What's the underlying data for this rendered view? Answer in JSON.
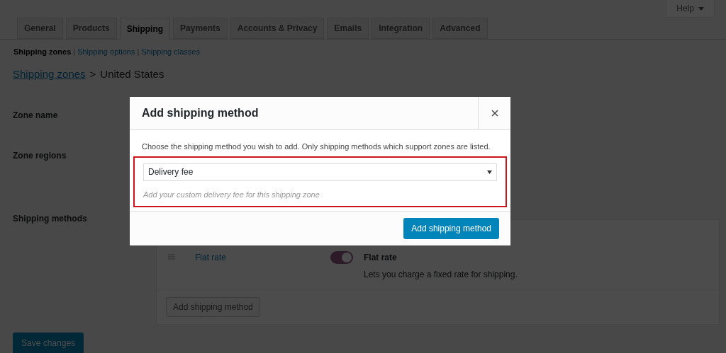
{
  "help_button": {
    "label": "Help"
  },
  "tabs": [
    {
      "label": "General",
      "selected": false
    },
    {
      "label": "Products",
      "selected": false
    },
    {
      "label": "Shipping",
      "selected": true
    },
    {
      "label": "Payments",
      "selected": false
    },
    {
      "label": "Accounts & Privacy",
      "selected": false
    },
    {
      "label": "Emails",
      "selected": false
    },
    {
      "label": "Integration",
      "selected": false
    },
    {
      "label": "Advanced",
      "selected": false
    }
  ],
  "subnav": [
    {
      "label": "Shipping zones",
      "selected": true
    },
    {
      "label": "Shipping options",
      "selected": false,
      "separator_before": "|"
    },
    {
      "label": "Shipping classes",
      "selected": false,
      "separator_before": "|"
    }
  ],
  "breadcrumb": {
    "link": "Shipping zones",
    "separator": ">",
    "current": "United States"
  },
  "fields": [
    {
      "label": "Zone name",
      "kind": "short"
    },
    {
      "label": "Zone regions",
      "kind": "tall"
    },
    {
      "label": "Shipping methods",
      "kind": "methods"
    }
  ],
  "methods": [
    {
      "title": "Flat rate",
      "enabled": true,
      "description_title": "Flat rate",
      "description": "Lets you charge a fixed rate for shipping."
    }
  ],
  "methods_add_button": "Add shipping method",
  "save_button": "Save changes",
  "modal": {
    "title": "Add shipping method",
    "description": "Choose the shipping method you wish to add. Only shipping methods which support zones are listed.",
    "select_value": "Delivery fee",
    "hint": "Add your custom delivery fee for this shipping zone",
    "highlighted": true,
    "submit": "Add shipping method"
  }
}
